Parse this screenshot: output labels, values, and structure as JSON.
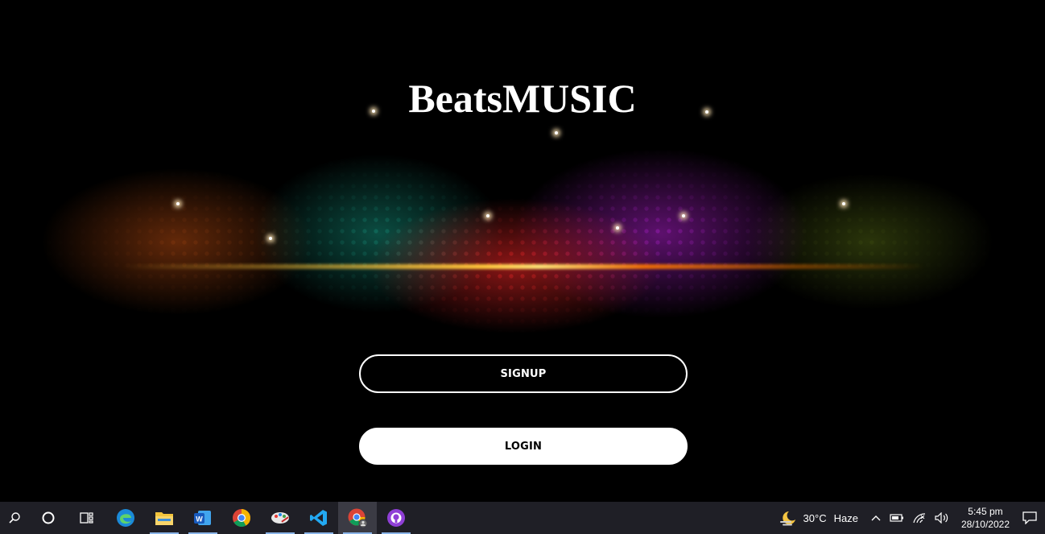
{
  "app": {
    "title_regular": "Beats",
    "title_bold": "MUSIC"
  },
  "buttons": {
    "signup_label": "SIGNUP",
    "login_label": "LOGIN"
  },
  "taskbar": {
    "apps": [
      {
        "name": "search-icon"
      },
      {
        "name": "cortana-icon"
      },
      {
        "name": "task-view-icon"
      },
      {
        "name": "edge-icon"
      },
      {
        "name": "file-explorer-icon"
      },
      {
        "name": "word-icon",
        "label": "W"
      },
      {
        "name": "chrome-icon"
      },
      {
        "name": "paint-icon"
      },
      {
        "name": "vscode-icon"
      },
      {
        "name": "chrome-profile-icon"
      },
      {
        "name": "github-desktop-icon"
      }
    ],
    "weather": {
      "temp": "30°C",
      "condition": "Haze"
    },
    "clock": {
      "time": "5:45 pm",
      "date": "28/10/2022"
    }
  },
  "colors": {
    "background": "#000000",
    "taskbar": "#1f1f26",
    "button_dark": "#000000",
    "button_light": "#ffffff"
  }
}
